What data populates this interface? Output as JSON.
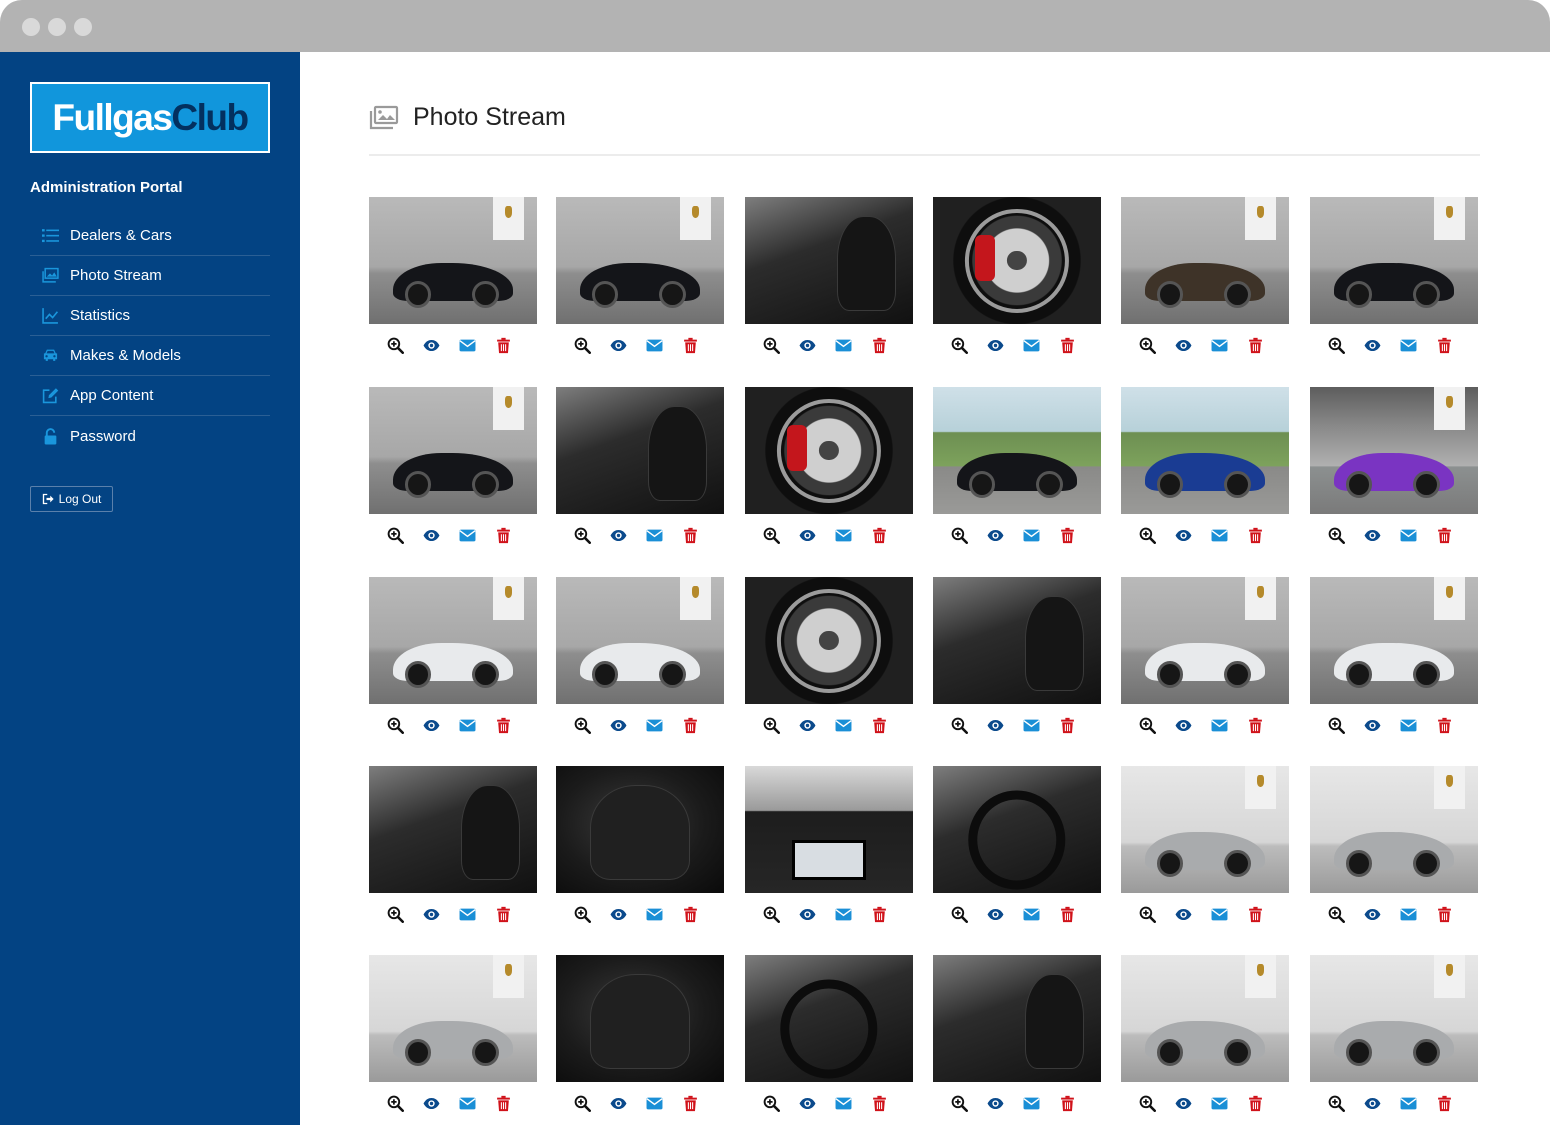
{
  "brand": {
    "part1": "Fullgas",
    "part2": "Club"
  },
  "sidebar": {
    "portal_title": "Administration Portal",
    "items": [
      {
        "label": "Dealers & Cars",
        "icon": "list-icon"
      },
      {
        "label": "Photo Stream",
        "icon": "images-icon"
      },
      {
        "label": "Statistics",
        "icon": "line-chart-icon"
      },
      {
        "label": "Makes & Models",
        "icon": "car-icon"
      },
      {
        "label": "App Content",
        "icon": "edit-icon"
      },
      {
        "label": "Password",
        "icon": "unlock-icon"
      }
    ],
    "logout_label": "Log Out"
  },
  "page": {
    "title": "Photo Stream",
    "icon": "images-icon"
  },
  "actions": [
    {
      "name": "zoom",
      "icon": "zoom-in-icon",
      "color": "#111111"
    },
    {
      "name": "view",
      "icon": "eye-icon",
      "color": "#0b4a8c"
    },
    {
      "name": "email",
      "icon": "envelope-icon",
      "color": "#1a8fd6"
    },
    {
      "name": "delete",
      "icon": "trash-icon",
      "color": "#d0121a"
    }
  ],
  "colors": {
    "sidebar": "#034383",
    "accent": "#1196dc",
    "delete": "#d0121a"
  },
  "photos": [
    {
      "subject": "black-porsche-cayman-front",
      "scene": "studio-dark",
      "car": "black",
      "banner": true
    },
    {
      "subject": "black-porsche-cayman-rear",
      "scene": "studio-dark",
      "car": "black",
      "banner": true
    },
    {
      "subject": "black-interior-steering",
      "scene": "interior"
    },
    {
      "subject": "wheel-red-caliper",
      "scene": "wheel"
    },
    {
      "subject": "porsche-side",
      "scene": "studio-dark",
      "car": "brown",
      "banner": true
    },
    {
      "subject": "black-porsche-front",
      "scene": "studio-dark",
      "car": "black",
      "banner": true
    },
    {
      "subject": "black-porsche-rear-wing",
      "scene": "studio-dark",
      "car": "black",
      "banner": true
    },
    {
      "subject": "interior-dashboard",
      "scene": "interior"
    },
    {
      "subject": "wheel-red-caliper",
      "scene": "wheel"
    },
    {
      "subject": "black-alfa-romeo-gt",
      "scene": "outdoor",
      "car": "black"
    },
    {
      "subject": "blue-alfa-romeo-gt",
      "scene": "outdoor",
      "car": "blue"
    },
    {
      "subject": "purple-lamborghini",
      "scene": "showroom",
      "car": "purple",
      "banner": true
    },
    {
      "subject": "white-porsche-cayman-front",
      "scene": "studio-dark",
      "car": "white",
      "banner": true
    },
    {
      "subject": "white-porsche-cayman-rear",
      "scene": "studio-dark",
      "car": "white",
      "banner": true
    },
    {
      "subject": "silver-wheel",
      "scene": "wheel"
    },
    {
      "subject": "interior-door-view",
      "scene": "interior"
    },
    {
      "subject": "white-porsche-side",
      "scene": "studio-dark",
      "car": "white",
      "banner": true
    },
    {
      "subject": "white-porsche-front",
      "scene": "studio-dark",
      "car": "white",
      "banner": true
    },
    {
      "subject": "interior-seats",
      "scene": "interior"
    },
    {
      "subject": "leather-headrest-crest",
      "scene": "leather"
    },
    {
      "subject": "dashboard-sat-nav",
      "scene": "dash"
    },
    {
      "subject": "steering-wheel-crest",
      "scene": "interior-steer"
    },
    {
      "subject": "silver-boxster-front",
      "scene": "studio-light",
      "car": "silver",
      "banner": true
    },
    {
      "subject": "silver-boxster-side",
      "scene": "studio-light",
      "car": "silver",
      "banner": true
    },
    {
      "subject": "silver-boxster-side-roof",
      "scene": "studio-light",
      "car": "silver",
      "banner": true
    },
    {
      "subject": "seat-headrest",
      "scene": "leather"
    },
    {
      "subject": "interior-steering",
      "scene": "interior-steer"
    },
    {
      "subject": "interior-dashboard-left",
      "scene": "interior"
    },
    {
      "subject": "silver-boxster-rear",
      "scene": "studio-light",
      "car": "silver",
      "banner": true
    },
    {
      "subject": "silver-boxster-rear-center",
      "scene": "studio-light",
      "car": "silver",
      "banner": true
    }
  ]
}
